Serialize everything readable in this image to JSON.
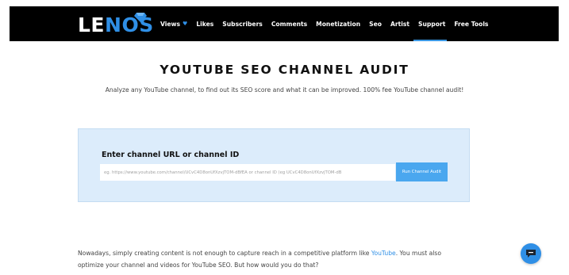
{
  "header": {
    "logo_prefix": "LE",
    "logo_suffix": "NOS",
    "nav": [
      {
        "label": "Views",
        "has_icon": true
      },
      {
        "label": "Likes"
      },
      {
        "label": "Subscribers"
      },
      {
        "label": "Comments"
      },
      {
        "label": "Monetization"
      },
      {
        "label": "Seo"
      },
      {
        "label": "Artist"
      },
      {
        "label": "Support"
      },
      {
        "label": "Free Tools"
      }
    ],
    "heart_glyph": "♥"
  },
  "hero": {
    "title": "YOUTUBE SEO CHANNEL AUDIT",
    "subtitle": "Analyze any YouTube channel, to find out its SEO score and what it can be improved. 100% fee YouTube channel audit!"
  },
  "audit": {
    "label": "Enter channel URL or channel ID",
    "placeholder": "eg. https://www.youtube.com/channel/UCvC4D8onUfXzvjTOM-dBfEA or channel ID (eg UCvC4D8onUfXzvjTOM-dB",
    "button_label": "Run Channel Audit"
  },
  "body": {
    "para_before": "Nowadays, simply creating content is not enough to capture reach in a competitive platform like ",
    "para_link": "YouTube",
    "para_after": ". You must also optimize your channel and videos for YouTube SEO. But how would you do that?"
  },
  "colors": {
    "accent": "#2f8fe6",
    "header_bg": "#000000",
    "audit_bg": "#dcecfb",
    "button_bg": "#4aa7ef"
  },
  "icons": {
    "logo_diamond": "diamond-icon",
    "chat": "chat-icon"
  }
}
